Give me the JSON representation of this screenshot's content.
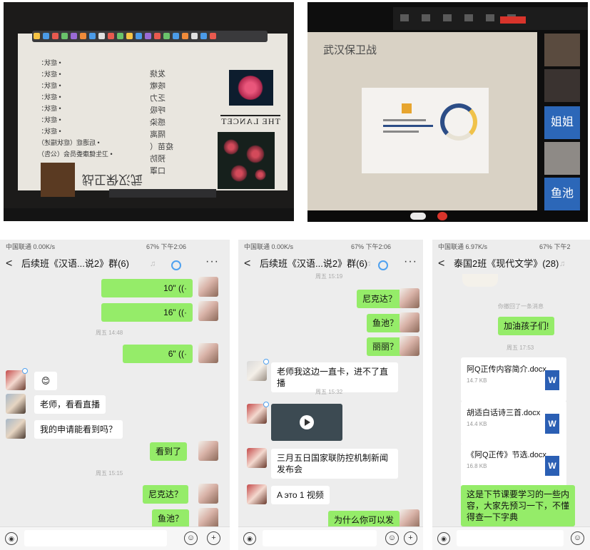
{
  "photo_left": {
    "bullets": [
      "• 症状：",
      "• 症状：",
      "• 症状：",
      "• 症状：",
      "• 症状：",
      "• 症状：",
      "• 症状：",
      "• 后遗症（症状描述）",
      "• 卫生健康委员会（公告）"
    ],
    "right_terms": [
      "发烧",
      "咳嗽",
      "乏力",
      "呼吸",
      "感染",
      "隔离",
      "疫苗（",
      "预防",
      "口罩"
    ],
    "lancet_text": "THE LANCET",
    "mirrored_title": "武汉保卫战"
  },
  "photo_right": {
    "slide_title": "武汉保卫战",
    "participant_label_1": "姐姐",
    "participant_label_2": "鱼池"
  },
  "chat1": {
    "status_left": "中国联通 ",
    "status_speed": "0.00K/s",
    "status_right": "67% 下午2:06",
    "title": "后续班《汉语...说2》群(6)",
    "more": "···",
    "voice1": "10\" ((·",
    "voice2": "16\" ((·",
    "time1": "周五 14:48",
    "voice3": "6\" ((·",
    "emoji_msg": "😊",
    "msg1": "老师，看看直播",
    "msg2": "我的申请能看到吗？",
    "msg3": "看到了",
    "time2": "周五 15:15",
    "msg4": "尼克达？",
    "msg5": "鱼池？"
  },
  "chat2": {
    "status_left": "中国联通 ",
    "status_speed": "0.00K/s",
    "status_right": "67% 下午2:06",
    "title": "后续班《汉语...说2》群(6)",
    "more": "···",
    "time0": "周五 15:19",
    "msg1": "尼克达？",
    "msg2": "鱼池？",
    "msg3": "丽丽？",
    "msg4": "老师我这边一直卡，进不了直播",
    "time1": "周五 15:32",
    "msg5": "三月五日国家联防控机制新闻发布会",
    "msg6": "A это 1 视频",
    "msg7": "为什么你可以发"
  },
  "chat3": {
    "status_left": "中国联通 ",
    "status_speed": "6.97K/s",
    "status_right": "67% 下午2",
    "title": "泰国2班《现代文学》(28)",
    "recall": "你撤回了一条消息",
    "msg1": "加油孩子们!",
    "time1": "周五 17:53",
    "file1_name": "阿Q正传内容简介.docx",
    "file1_size": "14.7 KB",
    "file2_name": "胡适白话诗三首.docx",
    "file2_size": "14.4 KB",
    "file3_name": "《阿Q正传》节选.docx",
    "file3_size": "16.8 KB",
    "word_letter": "W",
    "msg2": "这是下节课要学习的一些内容，大家先预习一下，不懂得查一下字典"
  },
  "colors": {
    "green_bubble": "#95ec69",
    "chat_bg": "#ededed",
    "zoom_blue": "#2c67b8"
  }
}
